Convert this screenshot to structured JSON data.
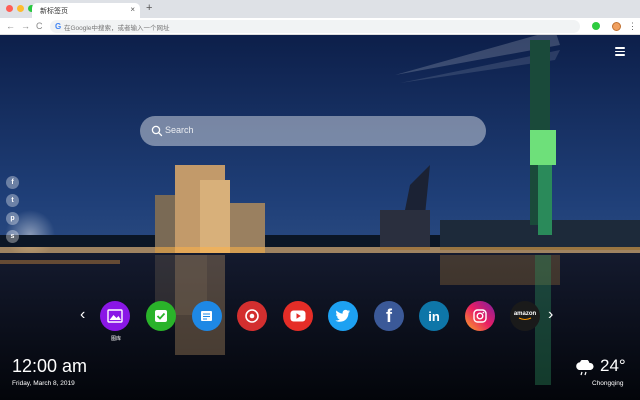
{
  "browser": {
    "tab_title": "新标签页",
    "tab_close": "×",
    "new_tab": "+",
    "nav_back": "←",
    "nav_forward": "→",
    "nav_reload": "C",
    "omnibox_g": "G",
    "omnibox_placeholder": "在Google中搜索，或者输入一个网址",
    "menu": "⋮",
    "traffic_lights": {
      "close": "#ff5f57",
      "minimize": "#febc2e",
      "maximize": "#28c840"
    }
  },
  "search": {
    "placeholder": "Search"
  },
  "social_links": [
    {
      "name": "facebook",
      "glyph": "f"
    },
    {
      "name": "twitter",
      "glyph": "t"
    },
    {
      "name": "pinterest",
      "glyph": "p"
    },
    {
      "name": "share",
      "glyph": "s"
    }
  ],
  "tiles": [
    {
      "name": "gallery",
      "label": "图库",
      "color": "#8a17e6"
    },
    {
      "name": "check",
      "label": "",
      "color": "#2ab32a"
    },
    {
      "name": "notes",
      "label": "",
      "color": "#1e88e5"
    },
    {
      "name": "chrome",
      "label": "",
      "color": "#d32f2f"
    },
    {
      "name": "youtube",
      "label": "",
      "color": "#e52d27"
    },
    {
      "name": "twitter",
      "label": "",
      "color": "#1da1f2"
    },
    {
      "name": "facebook",
      "label": "",
      "color": "#3b5998"
    },
    {
      "name": "linkedin",
      "label": "",
      "color": "#0e76a8"
    },
    {
      "name": "instagram",
      "label": "",
      "color": "#c13584"
    },
    {
      "name": "amazon",
      "label": "amazon",
      "color": "#1a1a1a"
    }
  ],
  "tile_glyphs": {
    "facebook": "f",
    "linkedin": "in"
  },
  "carousel": {
    "prev": "‹",
    "next": "›"
  },
  "clock": {
    "time": "12:00 am",
    "date": "Friday, March 8, 2019"
  },
  "weather": {
    "temperature": "24°",
    "city": "Chongqing",
    "icon": "cloud-rain-icon"
  }
}
